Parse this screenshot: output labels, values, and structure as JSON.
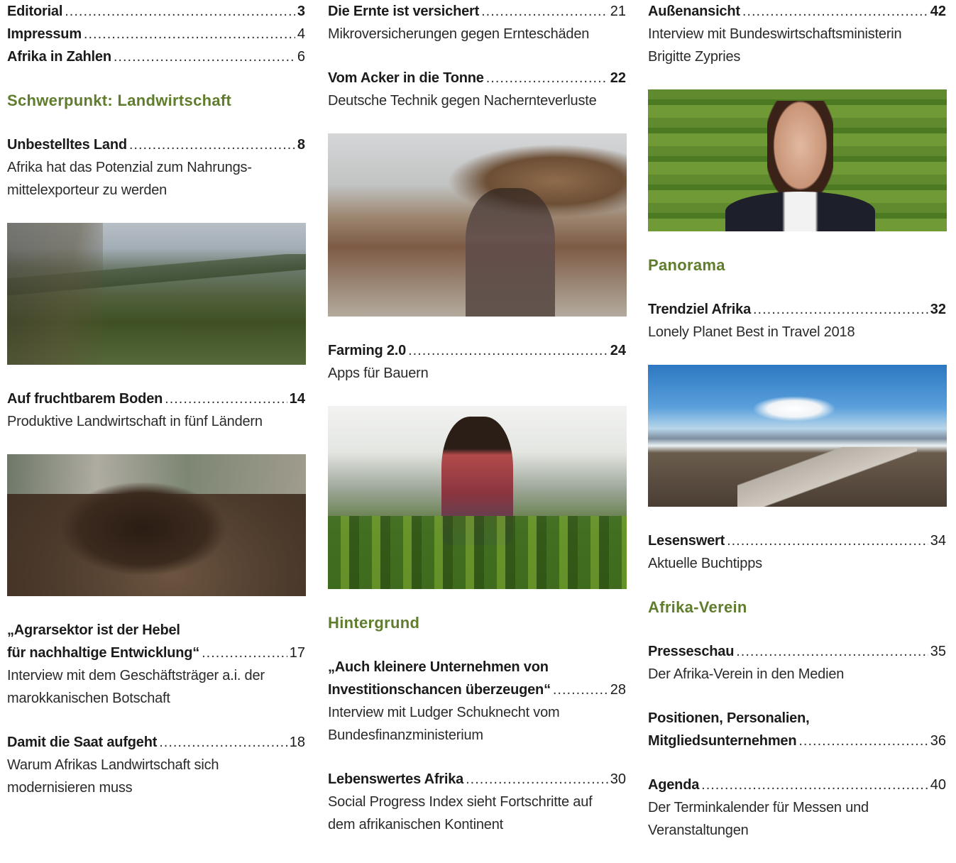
{
  "col1": {
    "e_editorial": {
      "title": "Editorial",
      "page": "3"
    },
    "e_impressum": {
      "title": "Impressum",
      "page": "4"
    },
    "e_zahlen": {
      "title": "Afrika in Zahlen",
      "page": "6"
    },
    "section": "Schwerpunkt: Landwirtschaft",
    "e_land": {
      "title": "Unbestelltes Land",
      "page": "8",
      "sub1": "Afrika hat das Potenzial zum Nahrungs-",
      "sub2": "mittelexporteur zu werden"
    },
    "e_boden": {
      "title": "Auf fruchtbarem Boden",
      "page": "14",
      "sub1": "Produktive Landwirtschaft in fünf Ländern"
    },
    "e_agrar": {
      "title1": "„Agrarsektor ist der Hebel",
      "title2": "für nachhaltige Entwicklung“",
      "page": "17",
      "sub1": "Interview mit dem Geschäftsträger a.i. der",
      "sub2": "marokkanischen Botschaft"
    },
    "e_saat": {
      "title": "Damit die Saat aufgeht",
      "page": "18",
      "sub1": "Warum Afrikas Landwirtschaft sich",
      "sub2": "modernisieren muss"
    }
  },
  "col2": {
    "e_ernte": {
      "title": "Die Ernte ist versichert",
      "page": "21",
      "sub1": "Mikroversicherungen gegen Ernteschäden"
    },
    "e_acker": {
      "title": "Vom Acker in die Tonne",
      "page": "22",
      "sub1": "Deutsche Technik gegen Nachernteverluste"
    },
    "e_farming": {
      "title": "Farming 2.0",
      "page": "24",
      "sub1": "Apps für Bauern"
    },
    "section": "Hintergrund",
    "e_invest": {
      "title1": "„Auch kleinere Unternehmen von",
      "title2": "Investitionschancen überzeugen“",
      "page": "28",
      "sub1": "Interview mit Ludger Schuknecht vom",
      "sub2": "Bundesfinanzministerium"
    },
    "e_lebens": {
      "title": "Lebenswertes Afrika",
      "page": "30",
      "sub1": "Social Progress Index sieht Fortschritte auf",
      "sub2": "dem afrikanischen Kontinent"
    }
  },
  "col3": {
    "e_aussen": {
      "title": "Außenansicht",
      "page": "42",
      "sub1": "Interview mit Bundeswirtschaftsministerin",
      "sub2": "Brigitte Zypries"
    },
    "section_panorama": "Panorama",
    "e_trend": {
      "title": "Trendziel Afrika",
      "page": "32",
      "sub1": "Lonely Planet Best in Travel 2018"
    },
    "e_lesens": {
      "title": "Lesenswert",
      "page": "34",
      "sub1": "Aktuelle Buchtipps"
    },
    "section_verein": "Afrika-Verein",
    "e_presse": {
      "title": "Presseschau",
      "page": "35",
      "sub1": "Der Afrika-Verein in den Medien"
    },
    "e_positionen": {
      "title1": "Positionen, Personalien,",
      "title2": "Mitgliedsunternehmen",
      "page": "36"
    },
    "e_agenda": {
      "title": "Agenda",
      "page": "40",
      "sub1": "Der Terminkalender für Messen und",
      "sub2": "Veranstaltungen"
    }
  },
  "colors": {
    "section": "#5f7d2c",
    "text": "#1b1b1b"
  }
}
